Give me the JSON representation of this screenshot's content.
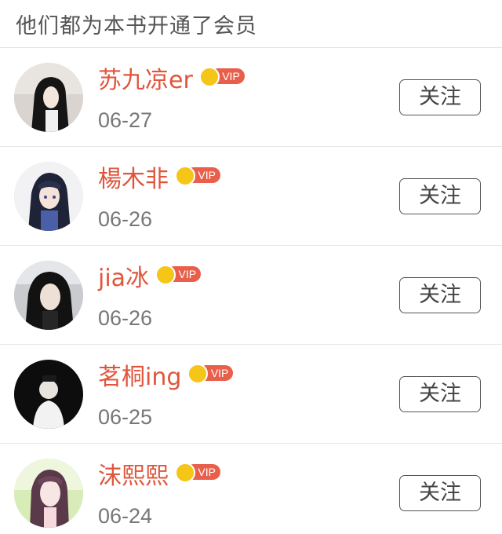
{
  "header": {
    "title": "他们都为本书开通了会员"
  },
  "vip_label": "VIP",
  "follow_label": "关注",
  "members": [
    {
      "name": "苏九凉er",
      "date": "06-27"
    },
    {
      "name": "楊木非",
      "date": "06-26"
    },
    {
      "name": "jia冰",
      "date": "06-26"
    },
    {
      "name": "茗桐ing",
      "date": "06-25"
    },
    {
      "name": "沫熙熙",
      "date": "06-24"
    }
  ],
  "colors": {
    "name": "#e0553c",
    "vip_badge": "#e8604b",
    "crown": "#f5c518"
  },
  "icons": {
    "vip_badge": "crown-icon"
  }
}
